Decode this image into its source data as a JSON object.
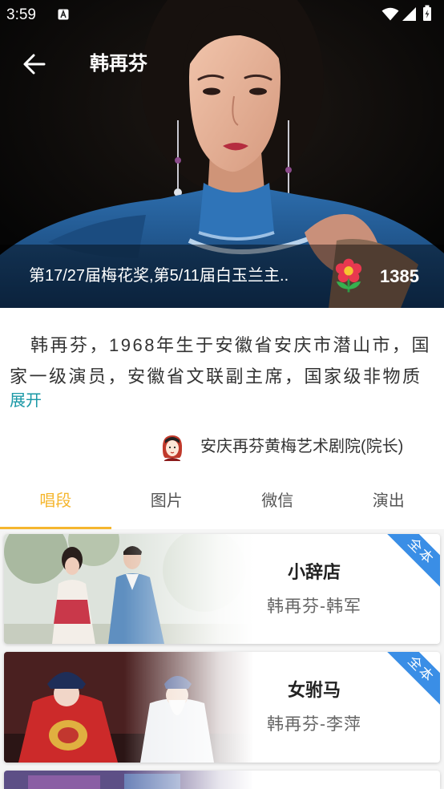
{
  "status_bar": {
    "time": "3:59",
    "icons": [
      "notification-a-icon",
      "wifi-icon",
      "signal-icon",
      "battery-icon"
    ]
  },
  "app_bar": {
    "title": "韩再芬",
    "back_icon": "arrow-left-icon"
  },
  "hero": {
    "honors": "第17/27届梅花奖,第5/11届白玉兰主..",
    "flower_icon": "flower-icon",
    "flower_count": "1385"
  },
  "bio": {
    "text": "韩再芬，1968年生于安徽省安庆市潜山市，国家一级演员，安徽省文联副主席，国家级非物质",
    "expand_label": "展开"
  },
  "affiliation": {
    "avatar_icon": "avatar",
    "text": "安庆再芬黄梅艺术剧院(院长)"
  },
  "tabs": [
    {
      "label": "唱段",
      "active": true
    },
    {
      "label": "图片",
      "active": false
    },
    {
      "label": "微信",
      "active": false
    },
    {
      "label": "演出",
      "active": false
    }
  ],
  "songs": [
    {
      "title": "小辞店",
      "performers": "韩再芬-韩军",
      "badge": "全本"
    },
    {
      "title": "女驸马",
      "performers": "韩再芬-李萍",
      "badge": "全本"
    }
  ],
  "colors": {
    "accent": "#f5b62e",
    "link": "#1a98a6",
    "badge": "#3a8ee6",
    "text_primary": "#333333",
    "text_secondary": "#666666"
  }
}
